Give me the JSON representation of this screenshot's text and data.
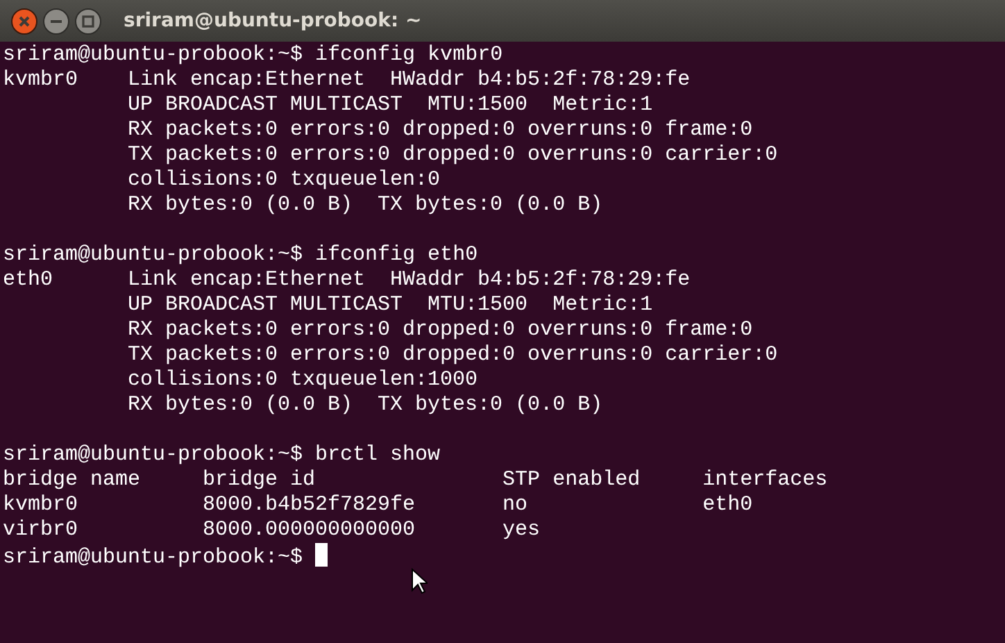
{
  "window": {
    "title": "sriram@ubuntu-probook: ~"
  },
  "commands": [
    {
      "prompt": "sriram@ubuntu-probook:~$",
      "command": "ifconfig kvmbr0",
      "output": [
        "kvmbr0    Link encap:Ethernet  HWaddr b4:b5:2f:78:29:fe",
        "          UP BROADCAST MULTICAST  MTU:1500  Metric:1",
        "          RX packets:0 errors:0 dropped:0 overruns:0 frame:0",
        "          TX packets:0 errors:0 dropped:0 overruns:0 carrier:0",
        "          collisions:0 txqueuelen:0",
        "          RX bytes:0 (0.0 B)  TX bytes:0 (0.0 B)"
      ]
    },
    {
      "prompt": "sriram@ubuntu-probook:~$",
      "command": "ifconfig eth0",
      "output": [
        "eth0      Link encap:Ethernet  HWaddr b4:b5:2f:78:29:fe",
        "          UP BROADCAST MULTICAST  MTU:1500  Metric:1",
        "          RX packets:0 errors:0 dropped:0 overruns:0 frame:0",
        "          TX packets:0 errors:0 dropped:0 overruns:0 carrier:0",
        "          collisions:0 txqueuelen:1000",
        "          RX bytes:0 (0.0 B)  TX bytes:0 (0.0 B)"
      ]
    },
    {
      "prompt": "sriram@ubuntu-probook:~$",
      "command": "brctl show",
      "output": [
        "bridge name     bridge id               STP enabled     interfaces",
        "kvmbr0          8000.b4b52f7829fe       no              eth0",
        "virbr0          8000.000000000000       yes"
      ]
    }
  ],
  "current_prompt": "sriram@ubuntu-probook:~$"
}
